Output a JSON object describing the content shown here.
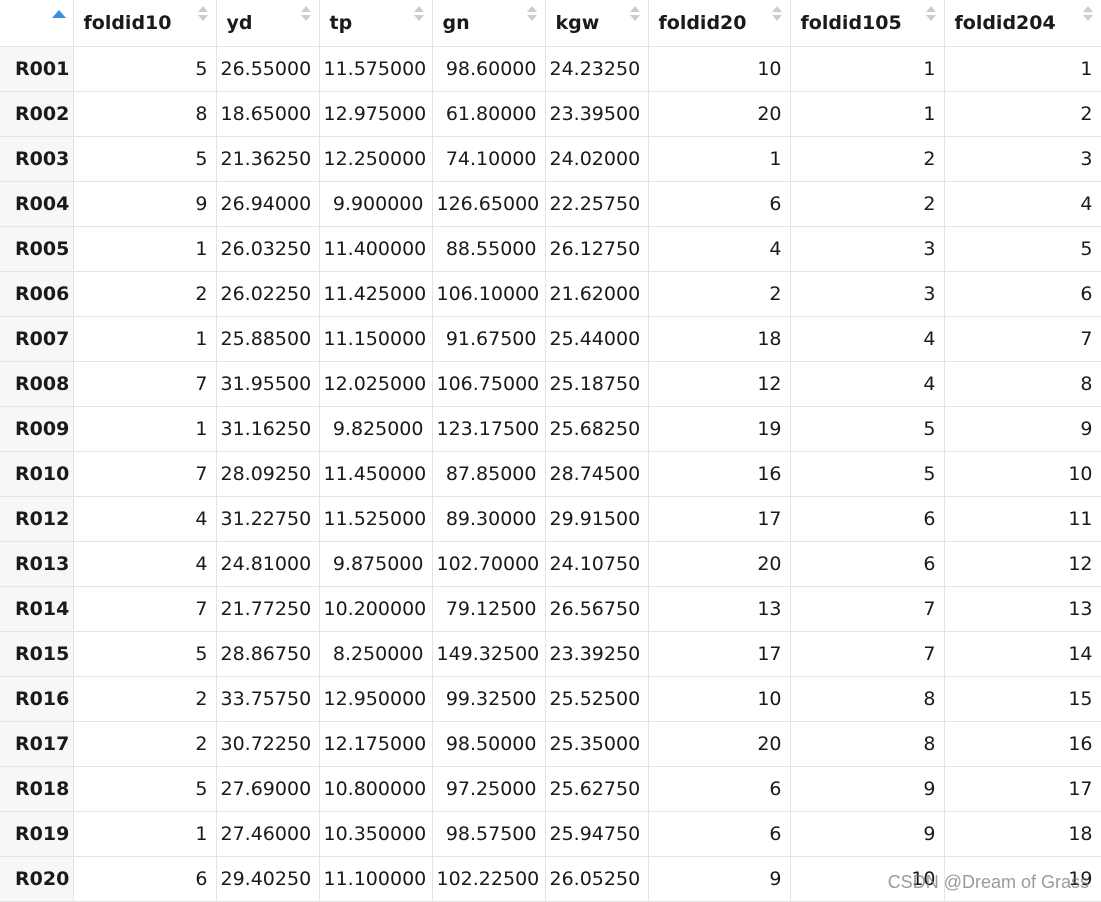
{
  "columns": [
    "foldid10",
    "yd",
    "tp",
    "gn",
    "kgw",
    "foldid20",
    "foldid105",
    "foldid204"
  ],
  "rows": [
    {
      "name": "R001",
      "cells": [
        "5",
        "26.55000",
        "11.575000",
        "98.60000",
        "24.23250",
        "10",
        "1",
        "1"
      ]
    },
    {
      "name": "R002",
      "cells": [
        "8",
        "18.65000",
        "12.975000",
        "61.80000",
        "23.39500",
        "20",
        "1",
        "2"
      ]
    },
    {
      "name": "R003",
      "cells": [
        "5",
        "21.36250",
        "12.250000",
        "74.10000",
        "24.02000",
        "1",
        "2",
        "3"
      ]
    },
    {
      "name": "R004",
      "cells": [
        "9",
        "26.94000",
        "9.900000",
        "126.65000",
        "22.25750",
        "6",
        "2",
        "4"
      ]
    },
    {
      "name": "R005",
      "cells": [
        "1",
        "26.03250",
        "11.400000",
        "88.55000",
        "26.12750",
        "4",
        "3",
        "5"
      ]
    },
    {
      "name": "R006",
      "cells": [
        "2",
        "26.02250",
        "11.425000",
        "106.10000",
        "21.62000",
        "2",
        "3",
        "6"
      ]
    },
    {
      "name": "R007",
      "cells": [
        "1",
        "25.88500",
        "11.150000",
        "91.67500",
        "25.44000",
        "18",
        "4",
        "7"
      ]
    },
    {
      "name": "R008",
      "cells": [
        "7",
        "31.95500",
        "12.025000",
        "106.75000",
        "25.18750",
        "12",
        "4",
        "8"
      ]
    },
    {
      "name": "R009",
      "cells": [
        "1",
        "31.16250",
        "9.825000",
        "123.17500",
        "25.68250",
        "19",
        "5",
        "9"
      ]
    },
    {
      "name": "R010",
      "cells": [
        "7",
        "28.09250",
        "11.450000",
        "87.85000",
        "28.74500",
        "16",
        "5",
        "10"
      ]
    },
    {
      "name": "R012",
      "cells": [
        "4",
        "31.22750",
        "11.525000",
        "89.30000",
        "29.91500",
        "17",
        "6",
        "11"
      ]
    },
    {
      "name": "R013",
      "cells": [
        "4",
        "24.81000",
        "9.875000",
        "102.70000",
        "24.10750",
        "20",
        "6",
        "12"
      ]
    },
    {
      "name": "R014",
      "cells": [
        "7",
        "21.77250",
        "10.200000",
        "79.12500",
        "26.56750",
        "13",
        "7",
        "13"
      ]
    },
    {
      "name": "R015",
      "cells": [
        "5",
        "28.86750",
        "8.250000",
        "149.32500",
        "23.39250",
        "17",
        "7",
        "14"
      ]
    },
    {
      "name": "R016",
      "cells": [
        "2",
        "33.75750",
        "12.950000",
        "99.32500",
        "25.52500",
        "10",
        "8",
        "15"
      ]
    },
    {
      "name": "R017",
      "cells": [
        "2",
        "30.72250",
        "12.175000",
        "98.50000",
        "25.35000",
        "20",
        "8",
        "16"
      ]
    },
    {
      "name": "R018",
      "cells": [
        "5",
        "27.69000",
        "10.800000",
        "97.25000",
        "25.62750",
        "6",
        "9",
        "17"
      ]
    },
    {
      "name": "R019",
      "cells": [
        "1",
        "27.46000",
        "10.350000",
        "98.57500",
        "25.94750",
        "6",
        "9",
        "18"
      ]
    },
    {
      "name": "R020",
      "cells": [
        "6",
        "29.40250",
        "11.100000",
        "102.22500",
        "26.05250",
        "9",
        "10",
        "19"
      ]
    }
  ],
  "watermark": "CSDN @Dream of Grass",
  "colors": {
    "sort_active": "#3a8fe0",
    "sort_idle": "#c9ced3",
    "rowname_bg": "#f5f7f8",
    "grid_line": "#e4e4e4"
  }
}
